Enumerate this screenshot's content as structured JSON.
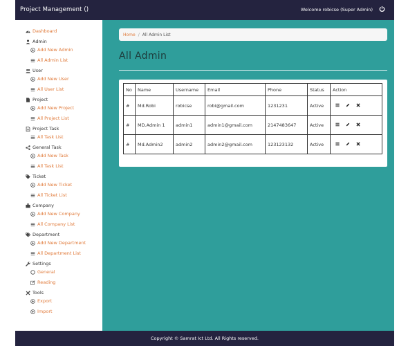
{
  "app": {
    "brand": "Project Management ()",
    "welcome": "Welcome robicse (Super Admin)"
  },
  "sidebar": {
    "dashboard": "Dashboard",
    "sections": [
      {
        "label": "Admin",
        "icon": "user-icon",
        "items": [
          {
            "label": "Add New Admin",
            "icon": "plus-circle-icon"
          },
          {
            "label": "All Admin List",
            "icon": "list-icon"
          }
        ]
      },
      {
        "label": "User",
        "icon": "users-icon",
        "items": [
          {
            "label": "Add New User",
            "icon": "plus-circle-icon"
          },
          {
            "label": "All User List",
            "icon": "list-icon"
          }
        ]
      },
      {
        "label": "Project",
        "icon": "file-icon",
        "items": [
          {
            "label": "Add New Project",
            "icon": "plus-circle-icon"
          },
          {
            "label": "All Project List",
            "icon": "list-icon"
          }
        ]
      },
      {
        "label": "Project Task",
        "icon": "file-text-icon",
        "items": [
          {
            "label": "All Task List",
            "icon": "list-icon"
          }
        ]
      },
      {
        "label": "General Task",
        "icon": "share-icon",
        "items": [
          {
            "label": "Add New Task",
            "icon": "plus-circle-icon"
          },
          {
            "label": "All Task List",
            "icon": "list-icon"
          }
        ]
      },
      {
        "label": "Ticket",
        "icon": "tag-icon",
        "items": [
          {
            "label": "Add New Ticket",
            "icon": "plus-circle-icon"
          },
          {
            "label": "All Ticket List",
            "icon": "list-icon"
          }
        ]
      },
      {
        "label": "Company",
        "icon": "briefcase-icon",
        "items": [
          {
            "label": "Add New Company",
            "icon": "plus-circle-icon"
          },
          {
            "label": "All Company List",
            "icon": "list-icon"
          }
        ]
      },
      {
        "label": "Department",
        "icon": "tags-icon",
        "items": [
          {
            "label": "Add New Department",
            "icon": "plus-circle-icon"
          },
          {
            "label": "All Department List",
            "icon": "list-icon"
          }
        ]
      },
      {
        "label": "Settings",
        "icon": "wrench-icon",
        "items": [
          {
            "label": "General",
            "icon": "circle-icon"
          },
          {
            "label": "Reading",
            "icon": "edit-icon"
          }
        ]
      },
      {
        "label": "Tools",
        "icon": "tools-icon",
        "items": [
          {
            "label": "Export",
            "icon": "plus-circle-icon"
          },
          {
            "label": "Import",
            "icon": "plus-circle-icon"
          }
        ]
      }
    ]
  },
  "breadcrumb": {
    "home": "Home",
    "separator": "/",
    "current": "All Admin List"
  },
  "page": {
    "title": "All Admin"
  },
  "table": {
    "headers": [
      "No",
      "Name",
      "Username",
      "Email",
      "Phone",
      "Status",
      "Action"
    ],
    "rows": [
      {
        "no": "#",
        "name": "Md.Robi",
        "username": "robicse",
        "email": "robi@gmail.com",
        "phone": "1231231",
        "status": "Active"
      },
      {
        "no": "#",
        "name": "MD.Admin 1",
        "username": "admin1",
        "email": "admin1@gmail.com",
        "phone": "2147483647",
        "status": "Active"
      },
      {
        "no": "#",
        "name": "Md.Admin2",
        "username": "admin2",
        "email": "admin2@gmail.com",
        "phone": "123123132",
        "status": "Active"
      }
    ]
  },
  "footer": {
    "text": "Copyright © Samrat Ict Ltd. All Rights reserved."
  },
  "colors": {
    "topbar": "#24233f",
    "content_bg": "#2f9e9b",
    "link": "#e07a3a"
  }
}
